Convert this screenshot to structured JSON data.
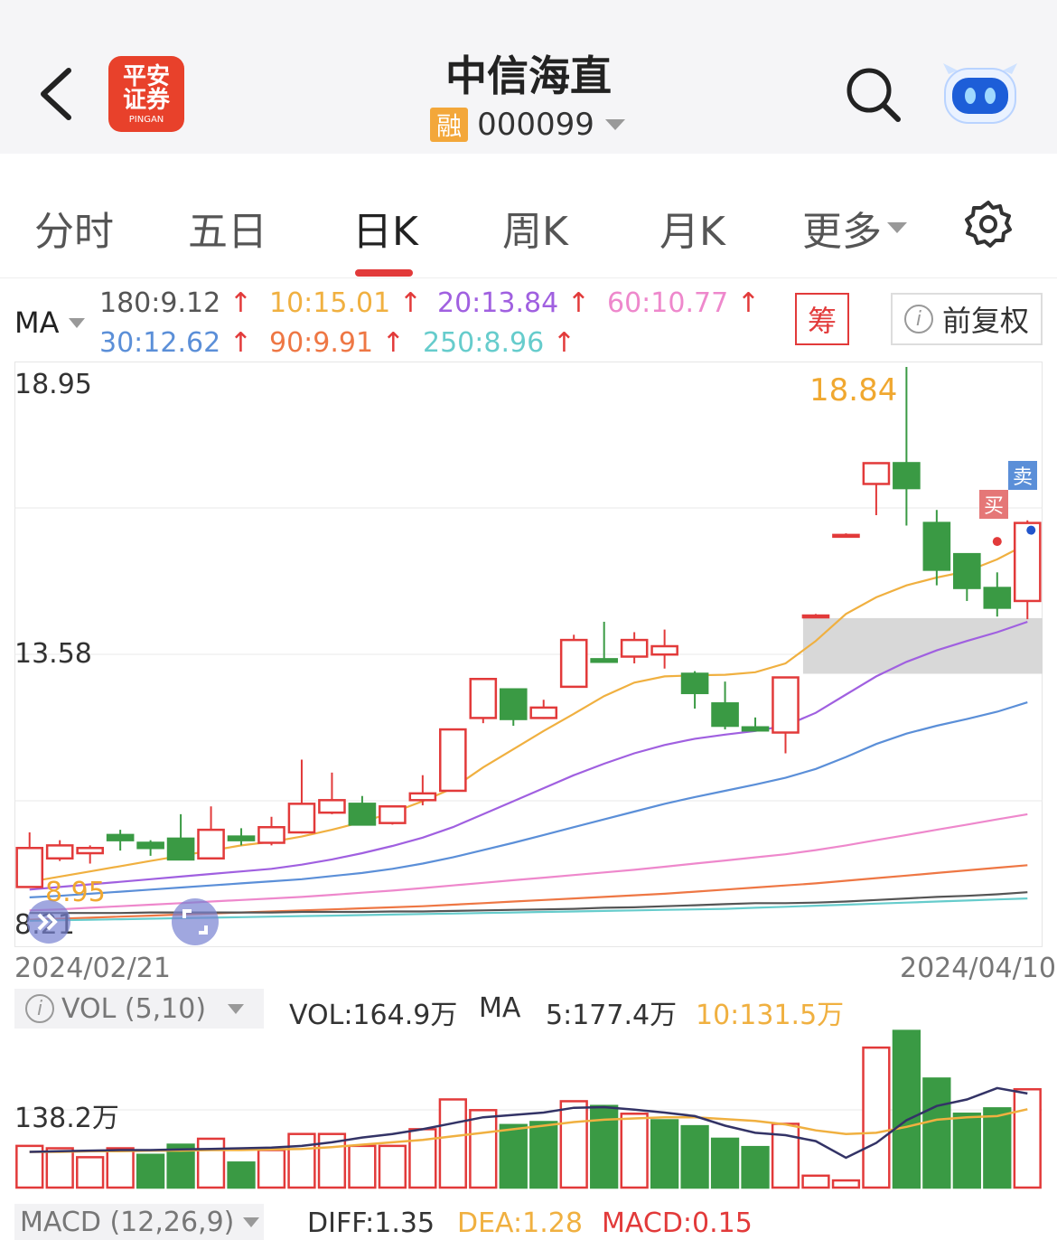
{
  "header": {
    "title": "中信海直",
    "badge": "融",
    "code": "000099",
    "logo_line1": "平安",
    "logo_line2": "证券",
    "logo_sub": "PINGAN"
  },
  "tabs": [
    {
      "label": "分时"
    },
    {
      "label": "五日"
    },
    {
      "label": "日K"
    },
    {
      "label": "周K"
    },
    {
      "label": "月K"
    },
    {
      "label": "更多"
    }
  ],
  "ma": {
    "label": "MA",
    "values": [
      {
        "text": "180:9.12",
        "color": "#555555"
      },
      {
        "text": "10:15.01",
        "color": "#f0b040"
      },
      {
        "text": "20:13.84",
        "color": "#a060e0"
      },
      {
        "text": "60:10.77",
        "color": "#ee88cc"
      },
      {
        "text": "30:12.62",
        "color": "#5b8fd8"
      },
      {
        "text": "90:9.91",
        "color": "#ee7744"
      },
      {
        "text": "250:8.96",
        "color": "#66cccc"
      }
    ],
    "arrow": "↑",
    "chip_button": "筹",
    "adjust_button": "前复权",
    "info_icon": "i"
  },
  "price_chart": {
    "y_max_label": "18.95",
    "y_mid_label": "13.58",
    "y_min_label": "8.21",
    "max_annotation": "18.84",
    "min_annotation": "8.95",
    "date_start": "2024/02/21",
    "date_end": "2024/04/10",
    "sell_tag": "卖",
    "buy_tag": "买"
  },
  "chart_data": {
    "type": "candlestick",
    "y_range": [
      8.21,
      18.95
    ],
    "candles": [
      {
        "o": 8.95,
        "c": 9.7,
        "h": 10.0,
        "l": 8.95
      },
      {
        "o": 9.5,
        "c": 9.75,
        "h": 9.85,
        "l": 9.45
      },
      {
        "o": 9.6,
        "c": 9.7,
        "h": 9.75,
        "l": 9.4
      },
      {
        "o": 9.95,
        "c": 9.85,
        "h": 10.05,
        "l": 9.65
      },
      {
        "o": 9.8,
        "c": 9.7,
        "h": 9.85,
        "l": 9.55
      },
      {
        "o": 9.88,
        "c": 9.48,
        "h": 10.35,
        "l": 9.48
      },
      {
        "o": 9.5,
        "c": 10.05,
        "h": 10.5,
        "l": 9.5
      },
      {
        "o": 9.92,
        "c": 9.85,
        "h": 10.08,
        "l": 9.75
      },
      {
        "o": 9.8,
        "c": 10.1,
        "h": 10.3,
        "l": 9.75
      },
      {
        "o": 10.0,
        "c": 10.55,
        "h": 11.4,
        "l": 9.98
      },
      {
        "o": 10.38,
        "c": 10.62,
        "h": 11.15,
        "l": 10.35
      },
      {
        "o": 10.55,
        "c": 10.15,
        "h": 10.7,
        "l": 10.15
      },
      {
        "o": 10.18,
        "c": 10.5,
        "h": 10.52,
        "l": 10.15
      },
      {
        "o": 10.62,
        "c": 10.75,
        "h": 11.1,
        "l": 10.52
      },
      {
        "o": 10.8,
        "c": 11.98,
        "h": 11.98,
        "l": 10.8
      },
      {
        "o": 12.2,
        "c": 12.95,
        "h": 12.95,
        "l": 12.1
      },
      {
        "o": 12.75,
        "c": 12.18,
        "h": 12.75,
        "l": 12.05
      },
      {
        "o": 12.2,
        "c": 12.4,
        "h": 12.55,
        "l": 12.18
      },
      {
        "o": 12.8,
        "c": 13.7,
        "h": 13.8,
        "l": 12.8
      },
      {
        "o": 13.33,
        "c": 13.28,
        "h": 14.05,
        "l": 13.28
      },
      {
        "o": 13.38,
        "c": 13.7,
        "h": 13.85,
        "l": 13.25
      },
      {
        "o": 13.42,
        "c": 13.58,
        "h": 13.9,
        "l": 13.15
      },
      {
        "o": 13.05,
        "c": 12.68,
        "h": 13.1,
        "l": 12.38
      },
      {
        "o": 12.48,
        "c": 12.05,
        "h": 12.9,
        "l": 11.98
      },
      {
        "o": 12.02,
        "c": 11.96,
        "h": 12.21,
        "l": 11.94
      },
      {
        "o": 11.92,
        "c": 12.98,
        "h": 12.98,
        "l": 11.52
      },
      {
        "o": 14.14,
        "c": 14.17,
        "h": 14.2,
        "l": 14.12
      },
      {
        "o": 15.69,
        "c": 15.72,
        "h": 15.75,
        "l": 15.67
      },
      {
        "o": 16.7,
        "c": 17.1,
        "h": 17.1,
        "l": 16.1
      },
      {
        "o": 17.1,
        "c": 16.62,
        "h": 18.95,
        "l": 15.9
      },
      {
        "o": 15.95,
        "c": 15.05,
        "h": 16.2,
        "l": 14.75
      },
      {
        "o": 15.35,
        "c": 14.7,
        "h": 15.35,
        "l": 14.45
      },
      {
        "o": 14.7,
        "c": 14.32,
        "h": 15.0,
        "l": 14.15
      },
      {
        "o": 14.45,
        "c": 15.95,
        "h": 16.0,
        "l": 14.1
      }
    ],
    "ma_lines": [
      {
        "name": "MA10",
        "color": "#f0b040",
        "values": [
          9.05,
          9.15,
          9.25,
          9.35,
          9.45,
          9.55,
          9.65,
          9.75,
          9.82,
          9.92,
          10.05,
          10.2,
          10.38,
          10.6,
          10.85,
          11.25,
          11.6,
          11.95,
          12.28,
          12.62,
          12.88,
          13.0,
          13.02,
          13.03,
          13.08,
          13.25,
          13.68,
          14.2,
          14.52,
          14.75,
          14.9,
          15.02,
          15.25,
          15.55
        ]
      },
      {
        "name": "MA20",
        "color": "#a060e0",
        "values": [
          8.9,
          8.95,
          9.0,
          9.05,
          9.1,
          9.15,
          9.2,
          9.25,
          9.3,
          9.38,
          9.48,
          9.6,
          9.74,
          9.9,
          10.1,
          10.35,
          10.6,
          10.85,
          11.1,
          11.32,
          11.52,
          11.68,
          11.8,
          11.88,
          11.95,
          12.05,
          12.3,
          12.65,
          13.0,
          13.28,
          13.5,
          13.68,
          13.85,
          14.05
        ]
      },
      {
        "name": "MA30",
        "color": "#5b8fd8",
        "values": [
          8.75,
          8.78,
          8.82,
          8.86,
          8.9,
          8.94,
          8.98,
          9.02,
          9.06,
          9.1,
          9.16,
          9.22,
          9.3,
          9.4,
          9.52,
          9.66,
          9.8,
          9.95,
          10.1,
          10.25,
          10.4,
          10.55,
          10.68,
          10.8,
          10.92,
          11.05,
          11.22,
          11.45,
          11.7,
          11.9,
          12.05,
          12.18,
          12.32,
          12.5
        ]
      },
      {
        "name": "MA60",
        "color": "#ee88cc",
        "values": [
          8.5,
          8.52,
          8.55,
          8.58,
          8.61,
          8.64,
          8.67,
          8.7,
          8.73,
          8.76,
          8.8,
          8.84,
          8.88,
          8.93,
          8.98,
          9.03,
          9.08,
          9.13,
          9.18,
          9.23,
          9.28,
          9.34,
          9.4,
          9.46,
          9.52,
          9.58,
          9.66,
          9.75,
          9.85,
          9.95,
          10.05,
          10.15,
          10.25,
          10.35
        ]
      },
      {
        "name": "MA90",
        "color": "#ee7744",
        "values": [
          8.32,
          8.34,
          8.36,
          8.38,
          8.4,
          8.42,
          8.44,
          8.46,
          8.48,
          8.5,
          8.52,
          8.54,
          8.56,
          8.58,
          8.61,
          8.64,
          8.67,
          8.7,
          8.73,
          8.76,
          8.79,
          8.82,
          8.86,
          8.9,
          8.94,
          8.98,
          9.02,
          9.07,
          9.12,
          9.17,
          9.22,
          9.27,
          9.32,
          9.37
        ]
      },
      {
        "name": "MA180",
        "color": "#555555",
        "values": [
          8.45,
          8.45,
          8.45,
          8.45,
          8.46,
          8.46,
          8.46,
          8.46,
          8.46,
          8.47,
          8.47,
          8.47,
          8.48,
          8.48,
          8.49,
          8.5,
          8.51,
          8.52,
          8.53,
          8.55,
          8.56,
          8.58,
          8.6,
          8.62,
          8.64,
          8.64,
          8.65,
          8.67,
          8.7,
          8.73,
          8.76,
          8.78,
          8.81,
          8.85
        ]
      },
      {
        "name": "MA250",
        "color": "#66cccc",
        "values": [
          8.3,
          8.31,
          8.32,
          8.33,
          8.34,
          8.35,
          8.36,
          8.37,
          8.38,
          8.39,
          8.4,
          8.41,
          8.42,
          8.43,
          8.44,
          8.45,
          8.46,
          8.47,
          8.48,
          8.49,
          8.5,
          8.51,
          8.52,
          8.53,
          8.55,
          8.57,
          8.59,
          8.61,
          8.63,
          8.65,
          8.67,
          8.69,
          8.71,
          8.73
        ]
      }
    ],
    "volume": {
      "y_label": "138.2万",
      "bars": [
        70,
        66,
        51,
        66,
        55,
        72,
        82,
        42,
        63,
        90,
        90,
        70,
        70,
        98,
        148,
        130,
        105,
        110,
        145,
        137,
        124,
        113,
        103,
        82,
        68,
        107,
        20,
        12,
        235,
        263,
        183,
        124,
        133,
        165
      ],
      "up": [
        true,
        true,
        true,
        true,
        false,
        false,
        true,
        false,
        true,
        true,
        true,
        true,
        true,
        true,
        true,
        true,
        false,
        false,
        true,
        false,
        true,
        false,
        false,
        false,
        false,
        true,
        true,
        true,
        true,
        false,
        false,
        false,
        false,
        true
      ],
      "ma5": [
        60,
        61,
        62,
        63,
        63,
        64,
        65,
        66,
        67,
        70,
        76,
        84,
        90,
        98,
        108,
        118,
        122,
        126,
        134,
        135,
        131,
        126,
        120,
        104,
        92,
        88,
        78,
        50,
        75,
        113,
        137,
        148,
        167,
        158
      ],
      "ma10": [
        60,
        60,
        61,
        61,
        62,
        62,
        63,
        63,
        64,
        65,
        68,
        72,
        76,
        80,
        86,
        92,
        98,
        104,
        110,
        114,
        116,
        118,
        118,
        115,
        112,
        106,
        96,
        90,
        92,
        102,
        114,
        118,
        120,
        131.5
      ]
    }
  },
  "volume_row": {
    "label": "VOL (5,10)",
    "vol": "VOL:164.9万",
    "ma_label": "MA",
    "ma5": "5:177.4万",
    "ma10": "10:131.5万"
  },
  "macd_row": {
    "label": "MACD (12,26,9)",
    "diff": "DIFF:1.35",
    "dea": "DEA:1.28",
    "macd": "MACD:0.15"
  },
  "colors": {
    "up": "#e23a3a",
    "down": "#3a9a44",
    "grid": "#e8e8e8",
    "accent": "#e23a3a"
  }
}
